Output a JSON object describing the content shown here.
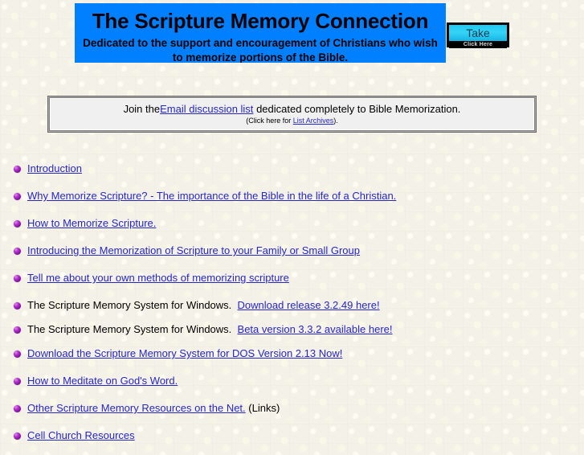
{
  "banner": {
    "title": "The Scripture Memory Connection",
    "tagline": "Dedicated to the support and encouragement of Christians who wish to memorize portions of the Bible.",
    "background_color": "#0080ff"
  },
  "take_button": {
    "label": "Take",
    "sublabel": "Click Here",
    "face_color": "#2ccdf4"
  },
  "email_notice": {
    "line1_before": "Join the",
    "line1_link": "Email discussion list",
    "line1_after": "dedicated completely to Bible Memorization.",
    "line2_before": "(Click here for",
    "line2_link": "List Archives",
    "line2_after": ")."
  },
  "link_color": "#2626cc",
  "bullet_color": "#8a1fa8",
  "links": [
    {
      "text": "Introduction",
      "is_link": true
    },
    {
      "text": "Why Memorize Scripture? - The importance of the Bible in the life of a Christian.",
      "is_link": true
    },
    {
      "text": "How to Memorize Scripture.",
      "is_link": true
    },
    {
      "text": "Introducing the Memorization of Scripture to your Family or Small Group",
      "is_link": true
    },
    {
      "text": "Tell me about your own methods of memorizing scripture",
      "is_link": true
    },
    {
      "prefix": "The Scripture Memory System for Windows.",
      "text": "Download release 3.2.49 here!",
      "is_link": true
    },
    {
      "prefix": "The Scripture Memory System for Windows.",
      "text": "Beta version 3.3.2 available here!",
      "is_link": true
    },
    {
      "text": "Download the Scripture Memory System for DOS Version 2.13 Now!",
      "is_link": true
    },
    {
      "text": "How to Meditate on God's Word.",
      "is_link": true
    },
    {
      "text": "Other Scripture Memory Resources on the Net.",
      "suffix": "(Links)",
      "is_link": true
    },
    {
      "text": "Cell Church Resources",
      "is_link": true
    }
  ]
}
